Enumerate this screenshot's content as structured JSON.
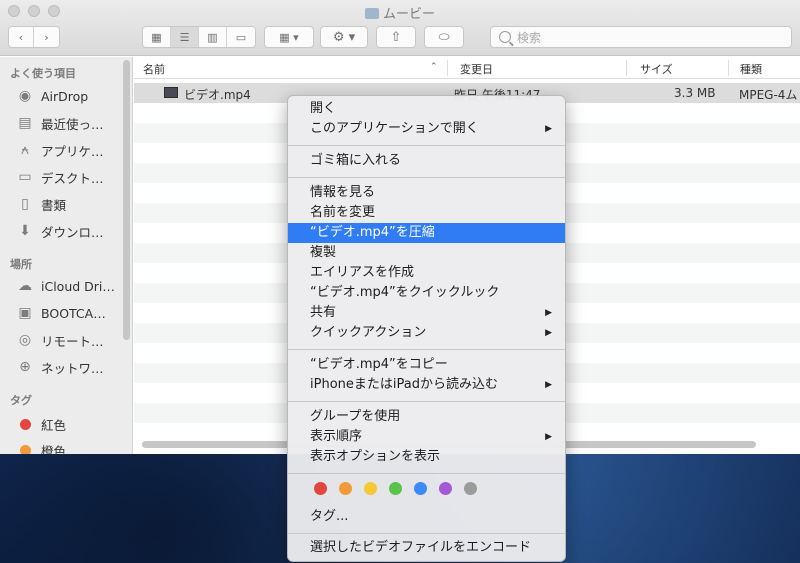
{
  "window": {
    "title": "ムービー"
  },
  "toolbar": {
    "back_icon": "chevron-left-icon",
    "forward_icon": "chevron-right-icon",
    "search_placeholder": "検索"
  },
  "sidebar": {
    "favorites_header": "よく使う項目",
    "favorites": [
      {
        "label": "AirDrop",
        "icon": "airdrop-icon"
      },
      {
        "label": "最近使っ…",
        "icon": "recents-icon"
      },
      {
        "label": "アプリケ…",
        "icon": "applications-icon"
      },
      {
        "label": "デスクト…",
        "icon": "desktop-icon"
      },
      {
        "label": "書類",
        "icon": "documents-icon"
      },
      {
        "label": "ダウンロ…",
        "icon": "downloads-icon"
      }
    ],
    "locations_header": "場所",
    "locations": [
      {
        "label": "iCloud Dri…",
        "icon": "icloud-icon"
      },
      {
        "label": "BOOTCA…",
        "icon": "disk-icon"
      },
      {
        "label": "リモート…",
        "icon": "remote-disc-icon"
      },
      {
        "label": "ネットワ…",
        "icon": "network-icon"
      }
    ],
    "tags_header": "タグ",
    "tags": [
      {
        "label": "紅色",
        "color": "#e2463f"
      },
      {
        "label": "橙色",
        "color": "#f29a38"
      }
    ]
  },
  "columns": {
    "name": "名前",
    "modified": "変更日",
    "size": "サイズ",
    "kind": "種類"
  },
  "files": [
    {
      "name": "ビデオ.mp4",
      "modified": "昨日 午後11:47",
      "size": "3.3 MB",
      "kind": "MPEG-4ム"
    }
  ],
  "context_menu": {
    "open": "開く",
    "open_with": "このアプリケーションで開く",
    "trash": "ゴミ箱に入れる",
    "get_info": "情報を見る",
    "rename": "名前を変更",
    "compress": "“ビデオ.mp4”を圧縮",
    "duplicate": "複製",
    "make_alias": "エイリアスを作成",
    "quick_look": "“ビデオ.mp4”をクイックルック",
    "share": "共有",
    "quick_actions": "クイックアクション",
    "copy": "“ビデオ.mp4”をコピー",
    "import_iphone": "iPhoneまたはiPadから読み込む",
    "use_groups": "グループを使用",
    "sort_by": "表示順序",
    "view_options": "表示オプションを表示",
    "tag_colors": [
      "#e2463f",
      "#f29a38",
      "#f4c935",
      "#5ac24d",
      "#3d8af7",
      "#a659d6",
      "#9b9b9b"
    ],
    "tags": "タグ...",
    "encode": "選択したビデオファイルをエンコード"
  }
}
